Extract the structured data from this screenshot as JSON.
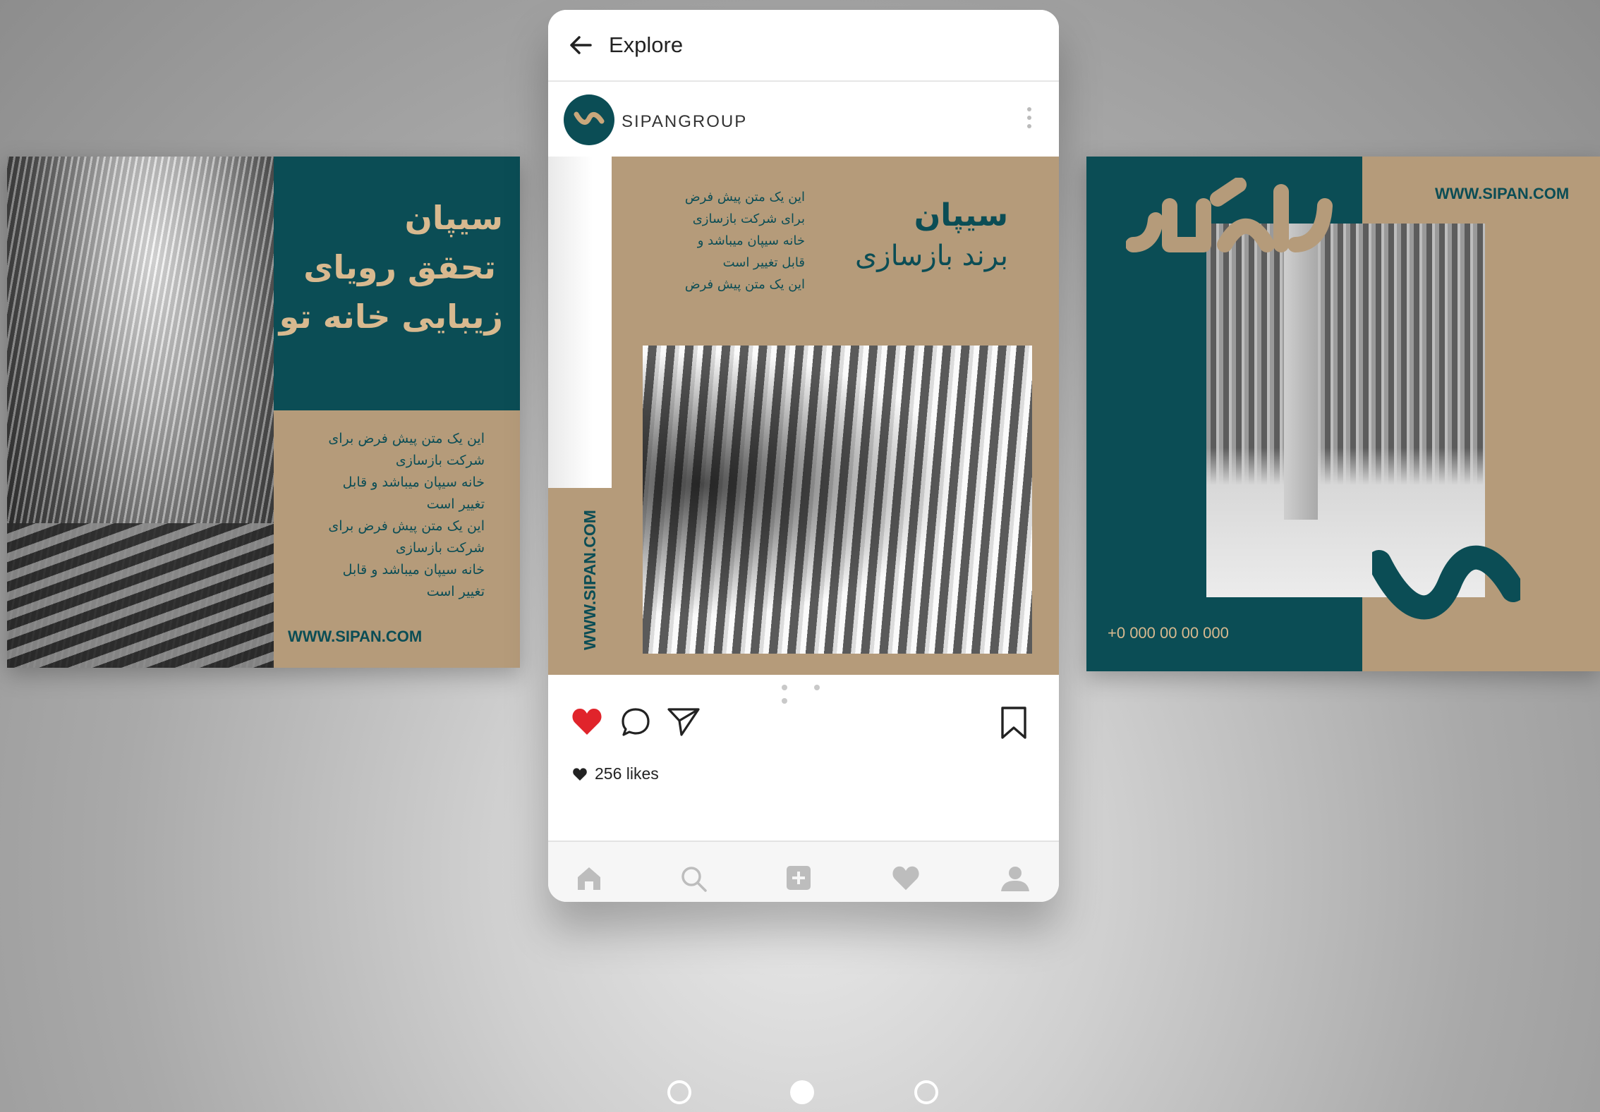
{
  "header": {
    "title": "Explore"
  },
  "post": {
    "username": "SIPANGROUP",
    "likes": "256 likes",
    "image": {
      "url_vertical": "WWW.SIPAN.COM",
      "title_line1": "سیپان",
      "title_line2": "برند بازسازی",
      "body_lines": [
        "این یک متن پیش فرض",
        "برای شرکت بازسازی",
        "خانه سیپان میباشد و",
        "قابل تغییر است",
        "این یک متن پیش فرض"
      ]
    },
    "carousel_index": 1,
    "carousel_count": 3
  },
  "left_card": {
    "title_line1": "سیپان",
    "title_line2": "تحقق رویای",
    "title_line3": "زیبایی خانه تو",
    "body_lines": [
      "این یک متن پیش فرض برای",
      "شرکت بازسازی",
      "خانه سیپان میباشد و قابل",
      "تغییر است",
      "این یک متن پیش فرض برای",
      "شرکت بازسازی",
      "خانه سیپان میباشد و قابل",
      "تغییر است"
    ],
    "url": "WWW.SIPAN.COM"
  },
  "right_card": {
    "url": "WWW.SIPAN.COM",
    "logo_text": "سیپان",
    "phone": "+0 000 00 00 000"
  },
  "bottom_nav": [
    "home-icon",
    "search-icon",
    "add-icon",
    "activity-heart-icon",
    "profile-icon"
  ],
  "page_indicator": {
    "count": 3,
    "active": 1
  },
  "colors": {
    "teal": "#0b4d55",
    "tan": "#b59b7a",
    "like_red": "#e0242b"
  }
}
